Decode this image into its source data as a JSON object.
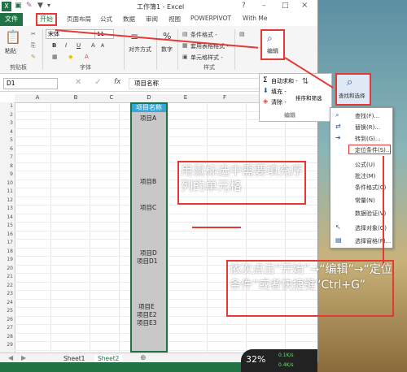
{
  "window": {
    "title": "工作簿1 - Excel",
    "help": "?",
    "minimize": "–",
    "restore": "□",
    "close": "×"
  },
  "quick_access": {
    "icons": [
      "excel-logo-icon",
      "save-icon",
      "eraser-icon",
      "filter-icon",
      "dropdown-icon"
    ]
  },
  "ribbon_tabs": [
    "文件",
    "开始",
    "插入",
    "页面布局",
    "公式",
    "数据",
    "审阅",
    "视图",
    "POWERPIVOT",
    "With Me"
  ],
  "ribbon": {
    "clipboard": {
      "paste": "粘贴",
      "label": "剪贴板"
    },
    "font": {
      "name": "宋体",
      "size": "11",
      "bold": "B",
      "italic": "I",
      "underline": "U",
      "grow": "A",
      "shrink": "A",
      "label": "字体"
    },
    "alignment": {
      "label": "对齐方式"
    },
    "number": {
      "label": "数字",
      "percent": "%"
    },
    "styles": {
      "cond": "条件格式 -",
      "table": "套用表格格式 -",
      "cell": "单元格样式 -",
      "label": "样式"
    },
    "editing": {
      "label": "编辑"
    }
  },
  "edit_panel": {
    "autosum": "自动求和 -",
    "fill": "填充 -",
    "clear": "清除 -",
    "sort": "排序和筛选",
    "find": "查找和选择",
    "label": "编辑"
  },
  "find_menu": {
    "items": [
      {
        "label": "查找(F)...",
        "icon": "search-icon"
      },
      {
        "label": "替换(R)...",
        "icon": "replace-icon"
      },
      {
        "label": "转到(G)...",
        "icon": "goto-arrow-icon"
      },
      {
        "label": "定位条件(S)...",
        "icon": ""
      },
      {
        "label": "公式(U)",
        "icon": ""
      },
      {
        "label": "批注(M)",
        "icon": ""
      },
      {
        "label": "条件格式(C)",
        "icon": ""
      },
      {
        "label": "常量(N)",
        "icon": ""
      },
      {
        "label": "数据验证(V)",
        "icon": ""
      },
      {
        "label": "选择对象(O)",
        "icon": "cursor-icon"
      },
      {
        "label": "选择窗格(P)...",
        "icon": "pane-icon"
      }
    ]
  },
  "formula_bar": {
    "name_box": "D1",
    "fx": "fx",
    "content": "项目名称"
  },
  "columns": [
    "A",
    "B",
    "C",
    "D",
    "E",
    "F",
    "G"
  ],
  "rows": [
    "1",
    "2",
    "3",
    "4",
    "5",
    "6",
    "7",
    "8",
    "9",
    "10",
    "11",
    "12",
    "13",
    "14",
    "15",
    "16",
    "17",
    "18",
    "19",
    "20",
    "21",
    "22",
    "23",
    "24",
    "25",
    "26",
    "27",
    "28",
    "29"
  ],
  "cells": {
    "D1": "项目名称",
    "D2": "项目A",
    "D8": "项目B",
    "D12": "项目C",
    "D19": "项目D",
    "D20": "项目D1",
    "D25": "项目E",
    "D26": "项目E2",
    "D27": "项目E3"
  },
  "sheets": [
    "Sheet1",
    "Sheet2"
  ],
  "annotations": {
    "a1": "用鼠标选中需要填充序列的单元格",
    "a2": "依次点击“开始”→“编辑”→“定位条件”或者快捷键“Ctrl+G”"
  },
  "gauge": {
    "percent": "32%",
    "up": "0.1K/s",
    "down": "0.4K/s"
  },
  "colors": {
    "excel_green": "#217346",
    "highlight_red": "#e53935",
    "header_blue": "#33a8dc"
  }
}
